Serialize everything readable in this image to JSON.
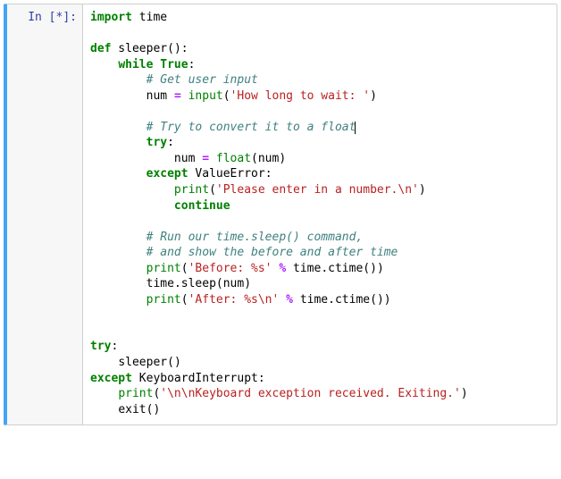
{
  "cell": {
    "prompt_prefix": "In [",
    "exec_indicator": "*",
    "prompt_suffix": "]:",
    "tokens": {
      "t0": "import",
      "t1": " time",
      "t2": "def",
      "t3": " sleeper",
      "t4": "(",
      "t5": ")",
      "t6": ":",
      "t7": "while",
      "t8": " ",
      "t9": "True",
      "t10": ":",
      "t11": "# Get user input",
      "t12": "num ",
      "t13": "=",
      "t14": " ",
      "t15": "input",
      "t16": "(",
      "t17": "'How long to wait: '",
      "t18": ")",
      "t19": "# Try to convert it to a float",
      "t20": "try",
      "t21": ":",
      "t22": "num ",
      "t23": "=",
      "t24": " ",
      "t25": "float",
      "t26": "(",
      "t27": "num",
      "t28": ")",
      "t29": "except",
      "t30": " ValueError",
      "t31": ":",
      "t32": "print",
      "t33": "(",
      "t34": "'Please enter in a number.\\n'",
      "t35": ")",
      "t36": "continue",
      "t37": "# Run our time.sleep() command,",
      "t38": "# and show the before and after time",
      "t39": "print",
      "t40": "(",
      "t41": "'Before: %s'",
      "t42": " ",
      "t43": "%",
      "t44": " time",
      "t45": ".",
      "t46": "ctime",
      "t47": "(",
      "t48": ")",
      "t49": ")",
      "t50": "time",
      "t51": ".",
      "t52": "sleep",
      "t53": "(",
      "t54": "num",
      "t55": ")",
      "t56": "print",
      "t57": "(",
      "t58": "'After: %s\\n'",
      "t59": " ",
      "t60": "%",
      "t61": " time",
      "t62": ".",
      "t63": "ctime",
      "t64": "(",
      "t65": ")",
      "t66": ")",
      "t67": "try",
      "t68": ":",
      "t69": "sleeper",
      "t70": "(",
      "t71": ")",
      "t72": "except",
      "t73": " KeyboardInterrupt",
      "t74": ":",
      "t75": "print",
      "t76": "(",
      "t77": "'\\n\\nKeyboard exception received. Exiting.'",
      "t78": ")",
      "t79": "exit",
      "t80": "(",
      "t81": ")"
    }
  }
}
